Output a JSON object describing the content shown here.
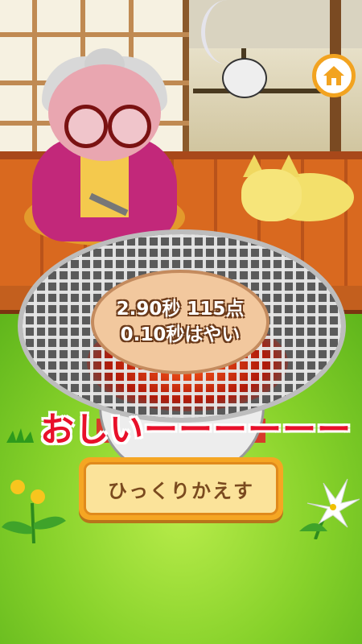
{
  "game": {
    "score_time": "2.90秒 115点",
    "timing_diff": "0.10秒はやい",
    "result_message": "おしいーーーーーー",
    "flip_button_label": "ひっくりかえす"
  },
  "ui": {
    "home_button_icon": "home-icon",
    "accent_color": "#f2a320",
    "result_color": "#e8102a"
  }
}
